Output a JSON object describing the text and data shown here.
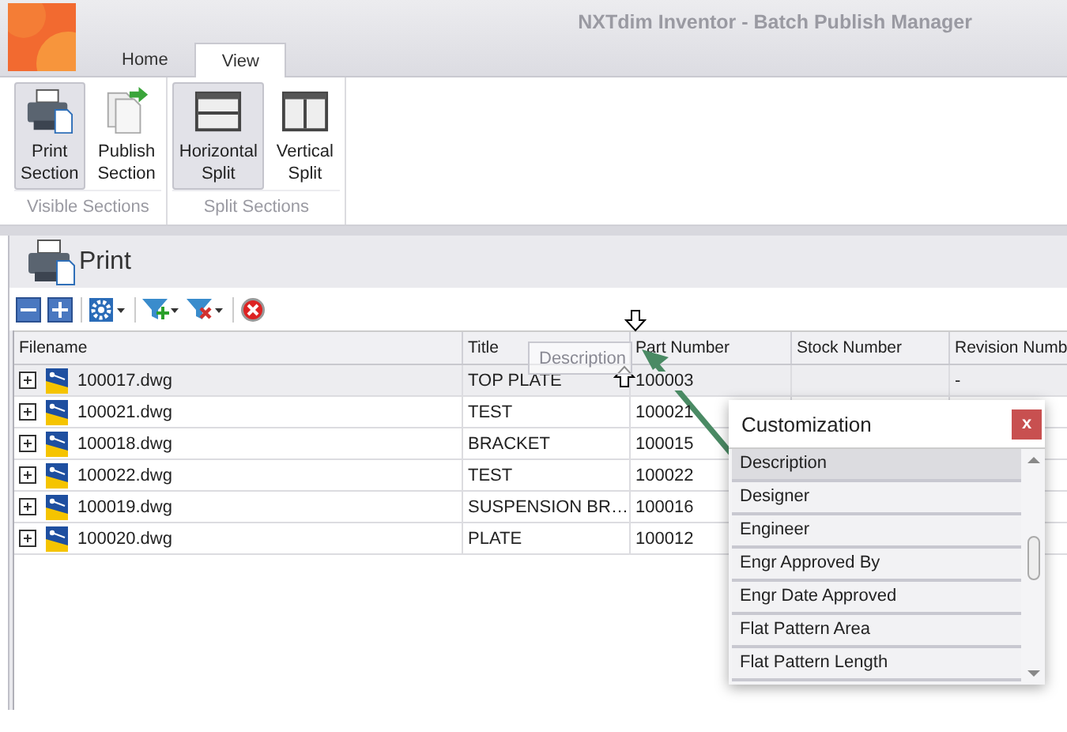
{
  "window": {
    "title": "NXTdim Inventor - Batch Publish Manager"
  },
  "tabs": [
    {
      "label": "Home",
      "selected": false
    },
    {
      "label": "View",
      "selected": true
    }
  ],
  "ribbon_groups": [
    {
      "label": "Visible Sections",
      "buttons": [
        {
          "label": "Print Section",
          "kind": "print",
          "selected": true
        },
        {
          "label": "Publish Section",
          "kind": "publish",
          "selected": false
        }
      ]
    },
    {
      "label": "Split Sections",
      "buttons": [
        {
          "label": "Horizontal Split",
          "kind": "hsplit",
          "selected": true
        },
        {
          "label": "Vertical Split",
          "kind": "vsplit",
          "selected": false
        }
      ]
    }
  ],
  "panel": {
    "title": "Print"
  },
  "toolbar": [
    {
      "kind": "collapse"
    },
    {
      "kind": "expand"
    },
    {
      "kind": "settings"
    },
    {
      "kind": "filter-add"
    },
    {
      "kind": "filter-remove"
    },
    {
      "kind": "cancel"
    }
  ],
  "grid": {
    "columns": [
      "Filename",
      "Title",
      "Part Number",
      "Stock Number",
      "Revision Numb"
    ],
    "rows": [
      {
        "filename": "100017.dwg",
        "title": "TOP PLATE",
        "part_number": "100003",
        "revision_number": "-",
        "selected": true
      },
      {
        "filename": "100021.dwg",
        "title": "TEST",
        "part_number": "100021",
        "selected": false
      },
      {
        "filename": "100018.dwg",
        "title": "BRACKET",
        "part_number": "100015",
        "selected": false
      },
      {
        "filename": "100022.dwg",
        "title": "TEST",
        "part_number": "100022",
        "selected": false
      },
      {
        "filename": "100019.dwg",
        "title": "SUSPENSION BR…",
        "part_number": "100016",
        "selected": false
      },
      {
        "filename": "100020.dwg",
        "title": "PLATE",
        "part_number": "100012",
        "selected": false
      }
    ]
  },
  "drag": {
    "label": "Description"
  },
  "customization": {
    "title": "Customization",
    "close": "x",
    "items": [
      {
        "label": "Description",
        "selected": true
      },
      {
        "label": "Designer",
        "selected": false
      },
      {
        "label": "Engineer",
        "selected": false
      },
      {
        "label": "Engr Approved By",
        "selected": false
      },
      {
        "label": "Engr Date Approved",
        "selected": false
      },
      {
        "label": "Flat Pattern Area",
        "selected": false
      },
      {
        "label": "Flat Pattern Length",
        "selected": false
      }
    ]
  }
}
